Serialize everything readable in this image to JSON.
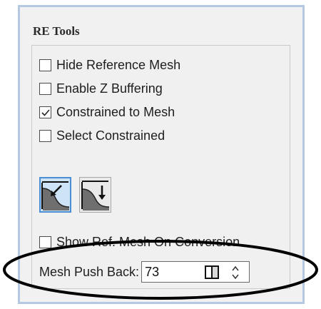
{
  "panel": {
    "title": "RE Tools",
    "checkboxes": [
      {
        "label": "Hide Reference Mesh",
        "checked": false
      },
      {
        "label": "Enable Z Buffering",
        "checked": false
      },
      {
        "label": "Constrained to Mesh",
        "checked": true
      },
      {
        "label": "Select Constrained",
        "checked": false
      },
      {
        "label": "Show Ref. Mesh On Conversion",
        "checked": false
      }
    ],
    "tools": [
      {
        "icon": "push-toward-mesh-icon",
        "active": true
      },
      {
        "icon": "push-down-mesh-icon",
        "active": false
      }
    ],
    "push_back": {
      "label": "Mesh Push Back:",
      "value": "73"
    },
    "colors": {
      "panel_border": "#b4c8e2",
      "active_tool_border": "#4a8ed6",
      "active_tool_fill": "#cfe3f7",
      "annotation_ellipse": "#000000"
    }
  }
}
